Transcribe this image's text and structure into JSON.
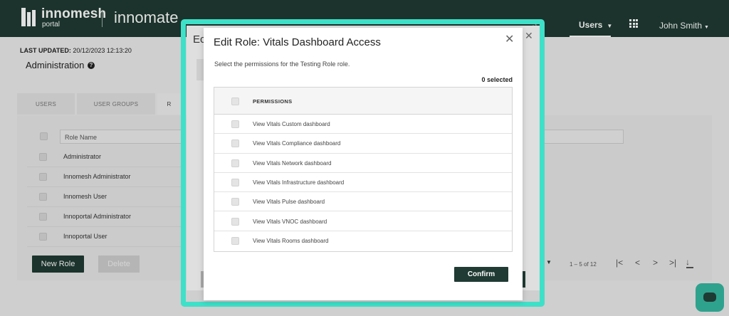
{
  "header": {
    "brand_main": "innomesh",
    "brand_sub": "portal",
    "brand_second": "innomate",
    "nav_ghost": "s",
    "nav_users": "Users",
    "user_name": "John Smith"
  },
  "page": {
    "last_updated_label": "LAST UPDATED:",
    "last_updated_value": "20/12/2023 12:13:20",
    "title": "Administration",
    "tabs": [
      "USERS",
      "USER GROUPS",
      "R"
    ],
    "grid_header": "Role Name",
    "roles": [
      "Administrator",
      "Innomesh Administrator",
      "Innomesh User",
      "Innoportal Administrator",
      "Innoportal User"
    ],
    "new_role_label": "New Role",
    "delete_label": "Delete",
    "pagination_text": "1 – 5 of 12"
  },
  "back_dialog": {
    "title": "Ec"
  },
  "modal": {
    "title": "Edit Role: Vitals Dashboard Access",
    "subtitle": "Select the permissions for the Testing Role role.",
    "selected_count": "0 selected",
    "column_header": "PERMISSIONS",
    "permissions": [
      "View Vitals Custom dashboard",
      "View Vitals Compliance dashboard",
      "View Vitals Network dashboard",
      "View Vitals Infrastructure dashboard",
      "View Vitals Pulse dashboard",
      "View Vitals VNOC dashboard",
      "View Vitals Rooms dashboard"
    ],
    "confirm_label": "Confirm"
  },
  "colors": {
    "brand_dark": "#1f3b33",
    "highlight": "#3fe0c8",
    "chat_button": "#2fa28e"
  },
  "icons": [
    "help-icon",
    "apps-grid-icon",
    "close-icon",
    "chevron-down-icon",
    "first-page-icon",
    "previous-page-icon",
    "next-page-icon",
    "last-page-icon",
    "download-icon",
    "chat-icon"
  ]
}
